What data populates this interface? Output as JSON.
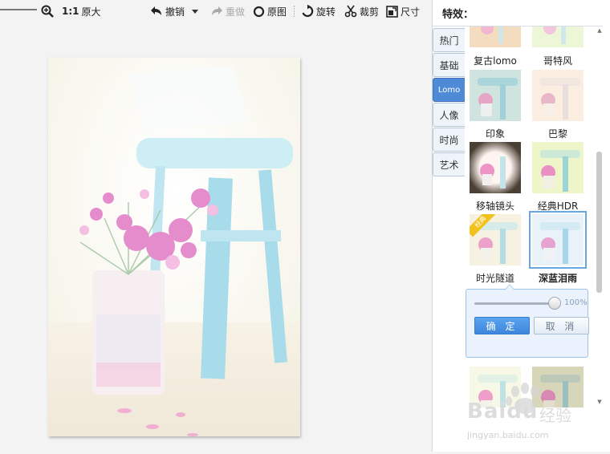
{
  "toolbar": {
    "actual_size_ratio": "1:1",
    "actual_size_label": "原大",
    "undo_label": "撤销",
    "redo_label": "重做",
    "original_label": "原图",
    "rotate_label": "旋转",
    "crop_label": "裁剪",
    "resize_label": "尺寸"
  },
  "panel": {
    "title": "特效：",
    "tabs": [
      {
        "label": "热门",
        "active": false
      },
      {
        "label": "基础",
        "active": false
      },
      {
        "label": "Lomo",
        "active": true
      },
      {
        "label": "人像",
        "active": false
      },
      {
        "label": "时尚",
        "active": false
      },
      {
        "label": "艺术",
        "active": false
      }
    ],
    "effects": [
      {
        "label": "复古lomo",
        "tint": "#f3dcc0",
        "selected": false
      },
      {
        "label": "哥特风",
        "tint": "#eef6d8",
        "selected": false
      },
      {
        "label": "印象",
        "tint": "#cfe3df",
        "selected": false
      },
      {
        "label": "巴黎",
        "tint": "#fbeee0",
        "selected": false
      },
      {
        "label": "移轴镜头",
        "tint": "#fff4f0",
        "selected": false
      },
      {
        "label": "经典HDR",
        "tint": "#eef5c8",
        "selected": false
      },
      {
        "label": "时光隧道",
        "tint": "#f7f1e2",
        "selected": false,
        "tag": "经典"
      },
      {
        "label": "深蓝泪雨",
        "tint": "#e9f2f8",
        "selected": true
      },
      {
        "label": "",
        "tint": "#f7f8e6",
        "selected": false
      },
      {
        "label": "",
        "tint": "#d8d6b8",
        "selected": false
      }
    ],
    "intensity": {
      "value_label": "100%",
      "value": 1.0
    },
    "confirm_label": "确 定",
    "cancel_label": "取 消"
  },
  "watermark": {
    "brand": "Baidu",
    "brand_cn": "经验",
    "url": "jingyan.baidu.com"
  },
  "colors": {
    "accent": "#4f8ad6",
    "photo_blue": "#a9dcea",
    "flower_pink": "#e58ccc"
  }
}
